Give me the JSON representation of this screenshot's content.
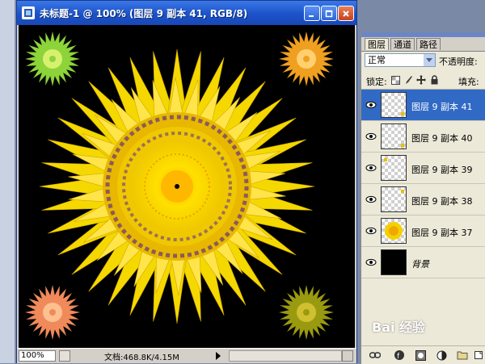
{
  "document": {
    "title": "未标题-1 @ 100% (图层 9 副本 41, RGB/8)",
    "zoom": "100%",
    "doc_info": "文档:468.8K/4.15M"
  },
  "layers_panel": {
    "tabs": [
      {
        "label": "图层",
        "active": true
      },
      {
        "label": "通道",
        "active": false
      },
      {
        "label": "路径",
        "active": false
      }
    ],
    "blend_mode": "正常",
    "opacity_label": "不透明度:",
    "lock_label": "锁定:",
    "fill_label": "填充:",
    "layers": [
      {
        "name": "图层 9 副本 41",
        "selected": true,
        "visible": true
      },
      {
        "name": "图层 9 副本 40",
        "selected": false,
        "visible": true
      },
      {
        "name": "图层 9 副本 39",
        "selected": false,
        "visible": true
      },
      {
        "name": "图层 9 副本 38",
        "selected": false,
        "visible": true
      },
      {
        "name": "图层 9 副本 37",
        "selected": false,
        "visible": true
      },
      {
        "name": "背景",
        "selected": false,
        "visible": true
      }
    ]
  },
  "watermark": "Bai 经验",
  "colors": {
    "titlebar": "#1c52c8",
    "selection": "#316ac5",
    "flower_main": "#f5d800",
    "flower_green": "#8cd43a",
    "flower_orange": "#f0a020",
    "flower_salmon": "#f08a5a",
    "flower_olive": "#9a9a10"
  },
  "icons": [
    "eye-icon",
    "lock-transparent-icon",
    "lock-brush-icon",
    "lock-move-icon",
    "lock-all-icon",
    "link-icon",
    "fx-icon",
    "mask-icon",
    "adjustment-icon",
    "folder-icon"
  ]
}
